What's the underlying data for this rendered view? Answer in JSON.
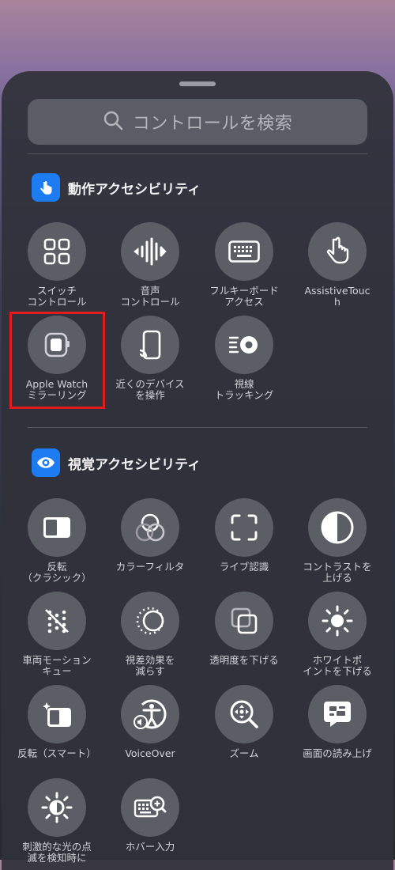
{
  "search": {
    "placeholder": "コントロールを検索"
  },
  "motor": {
    "title": "動作アクセシビリティ",
    "items": [
      {
        "label": "スイッチ\nコントロール",
        "icon": "grid-icon"
      },
      {
        "label": "音声\nコントロール",
        "icon": "waveform-icon"
      },
      {
        "label": "フルキーボード\nアクセス",
        "icon": "keyboard-icon"
      },
      {
        "label": "AssistiveTouc\nh",
        "icon": "hand-pointer-icon"
      },
      {
        "label": "Apple Watch\nミラーリング",
        "icon": "apple-watch-icon"
      },
      {
        "label": "近くのデバイス\nを操作",
        "icon": "device-cast-icon"
      },
      {
        "label": "視線\nトラッキング",
        "icon": "eye-tracking-icon"
      }
    ]
  },
  "vision": {
    "title": "視覚アクセシビリティ",
    "items": [
      {
        "label": "反転\n（クラシック）",
        "icon": "invert-classic-icon"
      },
      {
        "label": "カラーフィルタ",
        "icon": "color-filter-icon"
      },
      {
        "label": "ライブ認識",
        "icon": "viewfinder-icon"
      },
      {
        "label": "コントラストを\n上げる",
        "icon": "contrast-icon"
      },
      {
        "label": "車両モーション\nキュー",
        "icon": "vehicle-motion-icon"
      },
      {
        "label": "視差効果を\n減らす",
        "icon": "reduce-motion-icon"
      },
      {
        "label": "透明度を下げる",
        "icon": "reduce-transparency-icon"
      },
      {
        "label": "ホワイトポ\nイントを下げる",
        "icon": "brightness-icon"
      },
      {
        "label": "反転（スマート）",
        "icon": "invert-smart-icon"
      },
      {
        "label": "VoiceOver",
        "icon": "voiceover-icon"
      },
      {
        "label": "ズーム",
        "icon": "zoom-icon"
      },
      {
        "label": "画面の読み上げ",
        "icon": "speak-screen-icon"
      },
      {
        "label": "刺激的な光の点\n滅を検知時に",
        "icon": "dim-flashing-icon"
      },
      {
        "label": "ホバー入力",
        "icon": "hover-typing-icon"
      }
    ]
  }
}
